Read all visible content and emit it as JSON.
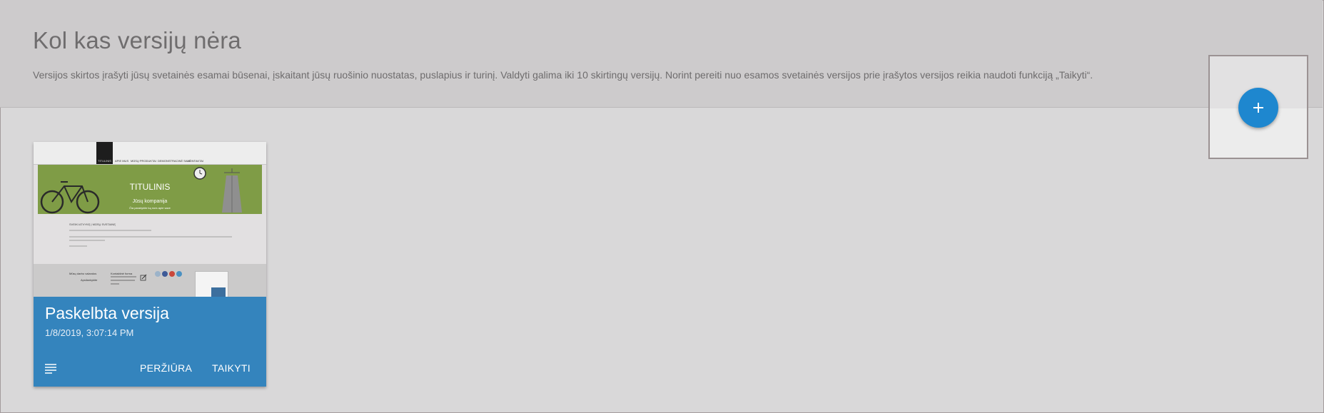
{
  "header": {
    "title": "Kol kas versijų nėra",
    "description": "Versijos skirtos įrašyti jūsų svetainės esamai būsenai, įskaitant jūsų ruošinio nuostatas, puslapius ir turinį. Valdyti galima iki 10 skirtingų versijų. Norint pereiti nuo esamos svetainės versijos prie įrašytos versijos reikia naudoti funkciją „Taikyti“."
  },
  "add_button": {
    "icon": "plus-icon"
  },
  "card": {
    "title": "Paskelbta versija",
    "date": "1/8/2019, 3:07:14 PM",
    "menu_icon": "notes-icon",
    "preview_label": "PERŽIŪRA",
    "apply_label": "TAIKYTI",
    "thumbnail": {
      "nav_items": [
        "TITULINIS",
        "APIE MUS",
        "MŪSŲ PRODUKTAI",
        "DEMONSTRACINĖ SALĖ",
        "KONTAKTAI"
      ],
      "hero_title": "TITULINIS",
      "hero_subtitle": "Jūsų kompanija",
      "hero_tagline": "Čia parašykite ką nors apie save",
      "section_title": "SVEIKI ATVYKĘ Į MŪSŲ SVETAINĘ",
      "footer_col1_title": "Mūsų darbo valandos",
      "footer_col1_sub": "Apsilankykite",
      "footer_col2_title": "Kontaktinė forma"
    },
    "colors": {
      "info_bg": "#3484bd",
      "hero_bg": "#7f9c46"
    }
  },
  "colors": {
    "accent": "#1e87cf",
    "header_bg": "#cdcbcc",
    "page_bg": "#d9d8d9"
  }
}
